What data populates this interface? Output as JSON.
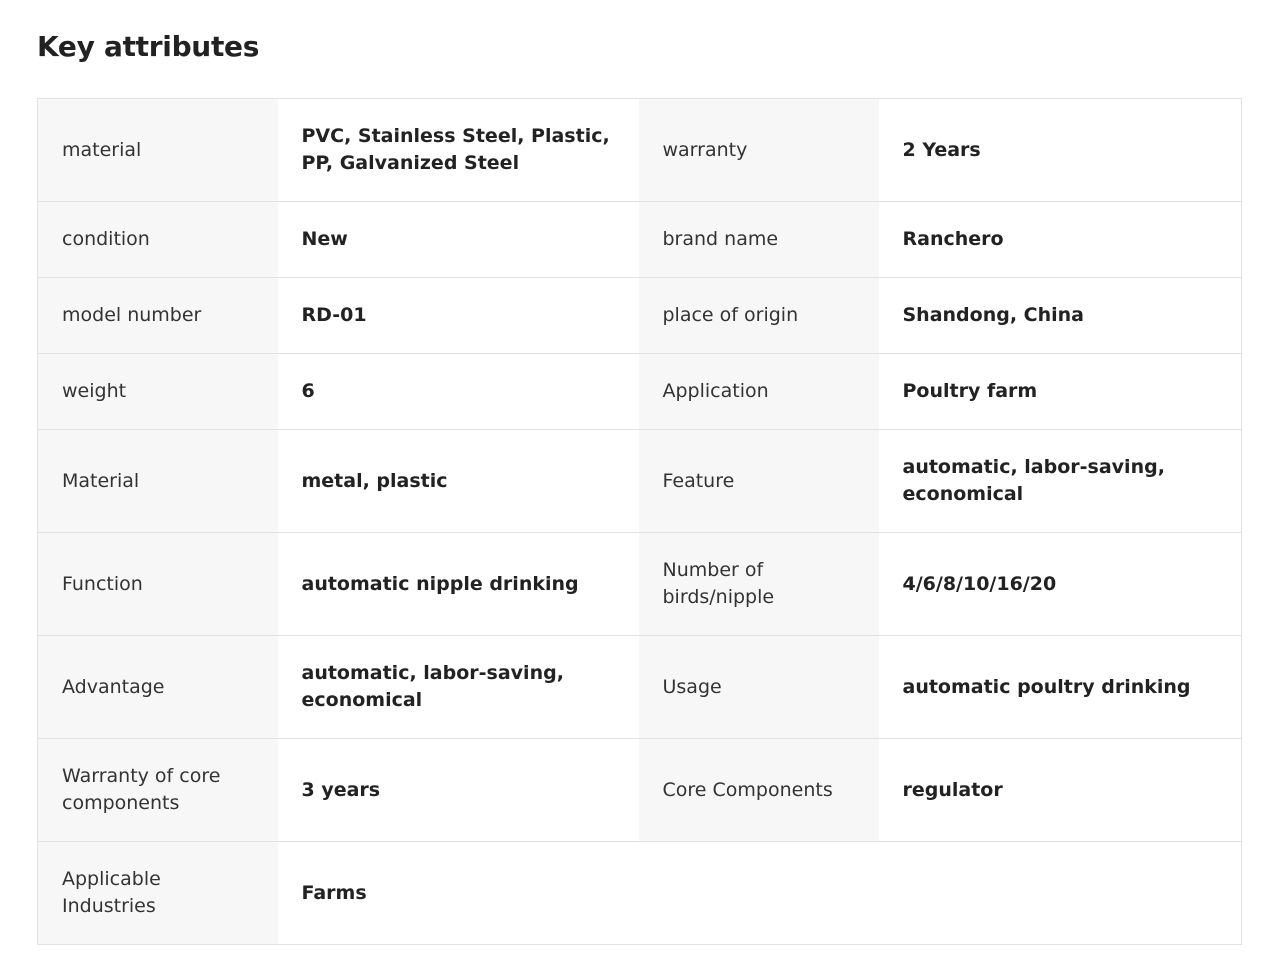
{
  "section": {
    "title": "Key attributes"
  },
  "rows": [
    {
      "k1": "material",
      "v1": "PVC, Stainless Steel, Plastic, PP, Galvanized Steel",
      "k2": "warranty",
      "v2": "2 Years"
    },
    {
      "k1": "condition",
      "v1": "New",
      "k2": "brand name",
      "v2": "Ranchero"
    },
    {
      "k1": "model number",
      "v1": "RD-01",
      "k2": "place of origin",
      "v2": "Shandong, China"
    },
    {
      "k1": "weight",
      "v1": "6",
      "k2": "Application",
      "v2": "Poultry farm"
    },
    {
      "k1": "Material",
      "v1": "metal, plastic",
      "k2": "Feature",
      "v2": "automatic, labor-saving, economical"
    },
    {
      "k1": "Function",
      "v1": "automatic nipple drinking",
      "k2": "Number of birds/nipple",
      "v2": "4/6/8/10/16/20"
    },
    {
      "k1": "Advantage",
      "v1": "automatic, labor-saving, economical",
      "k2": "Usage",
      "v2": "automatic poultry drinking"
    },
    {
      "k1": "Warranty of core components",
      "v1": "3 years",
      "k2": "Core Components",
      "v2": "regulator"
    },
    {
      "k1": "Applicable Industries",
      "v1": "Farms"
    }
  ]
}
